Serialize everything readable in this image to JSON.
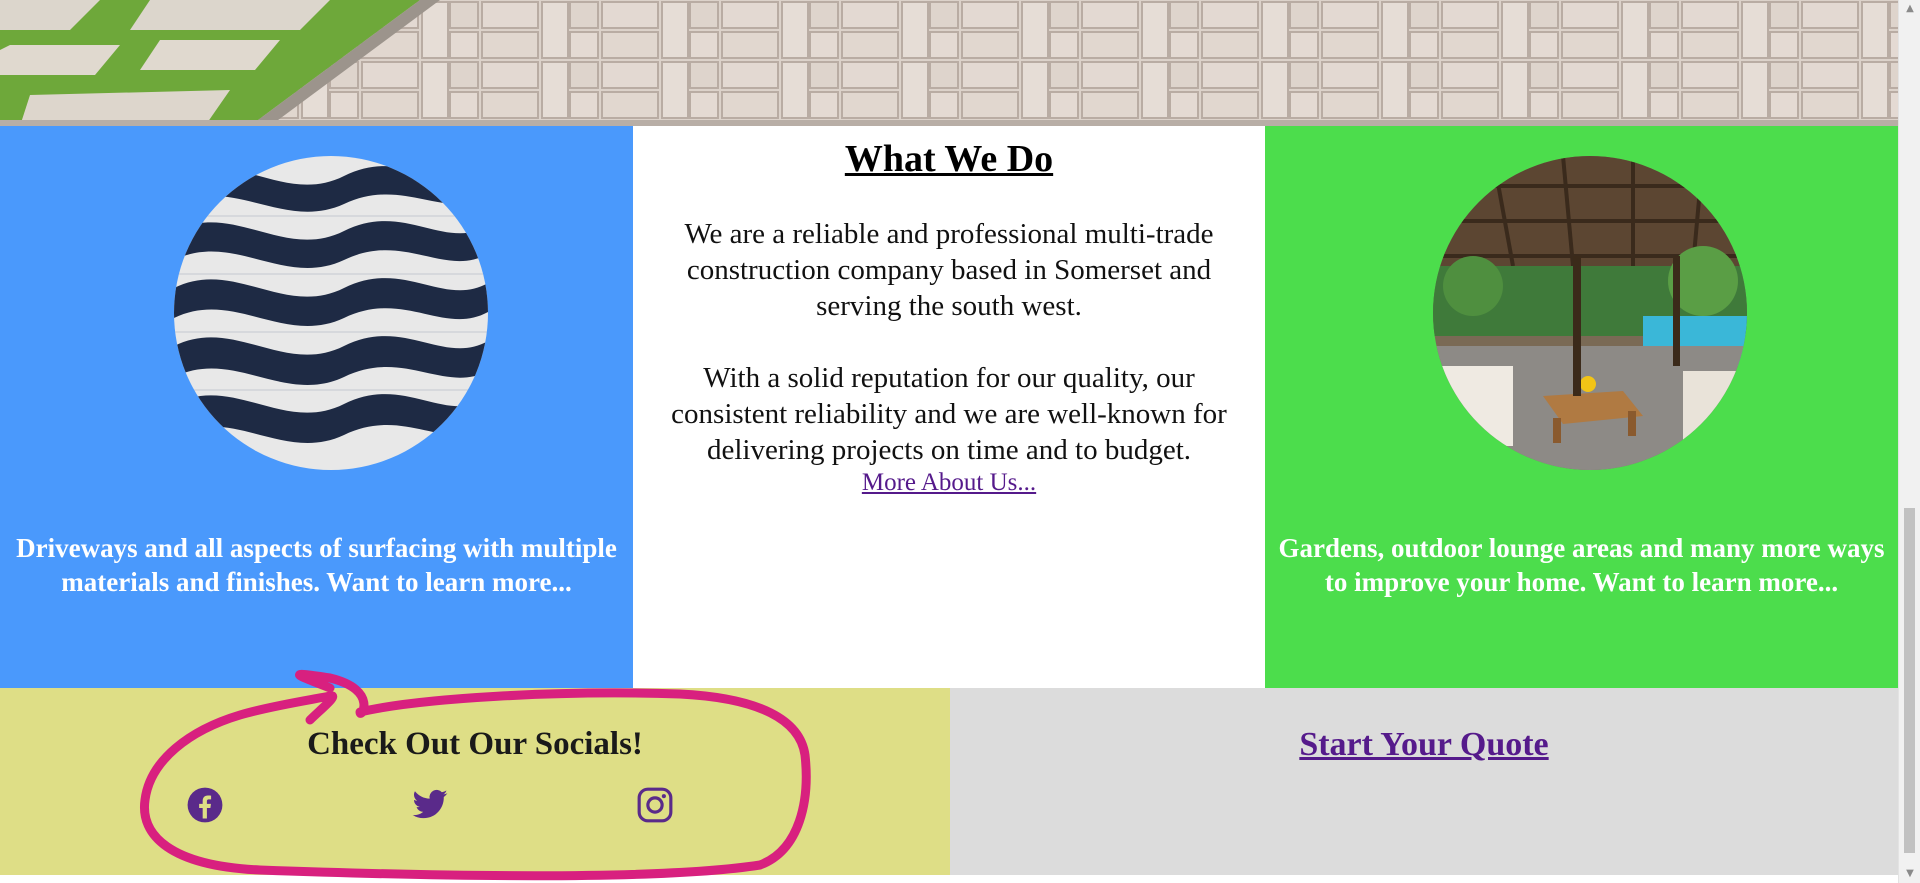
{
  "what_we_do": {
    "title": "What We Do",
    "paragraph_1": "We are a reliable and professional multi-trade construction company based in Somerset and serving the south west.",
    "paragraph_2": "With a solid reputation for our quality, our consistent reliability and we are well-known for delivering projects on time and to budget.",
    "more_link": "More About Us..."
  },
  "driveways": {
    "caption": "Driveways and all aspects of surfacing with multiple materials and finishes. Want to learn more...",
    "image": "wave-cobblestone-paving"
  },
  "gardens": {
    "caption": "Gardens, outdoor lounge areas and many more ways to improve your home. Want to learn more...",
    "image": "outdoor-lounge-pool"
  },
  "socials": {
    "title": "Check Out Our Socials!",
    "icons": [
      "facebook-icon",
      "twitter-icon",
      "instagram-icon"
    ]
  },
  "quote": {
    "link": "Start Your Quote"
  },
  "colors": {
    "blue_panel": "#4a99fc",
    "green_panel": "#4cdd4c",
    "socials_panel": "#dede86",
    "quote_panel": "#dcdcdc",
    "link_purple": "#551a8b",
    "scribble": "#d81b7d"
  },
  "hero": {
    "image": "paving-and-grass"
  }
}
